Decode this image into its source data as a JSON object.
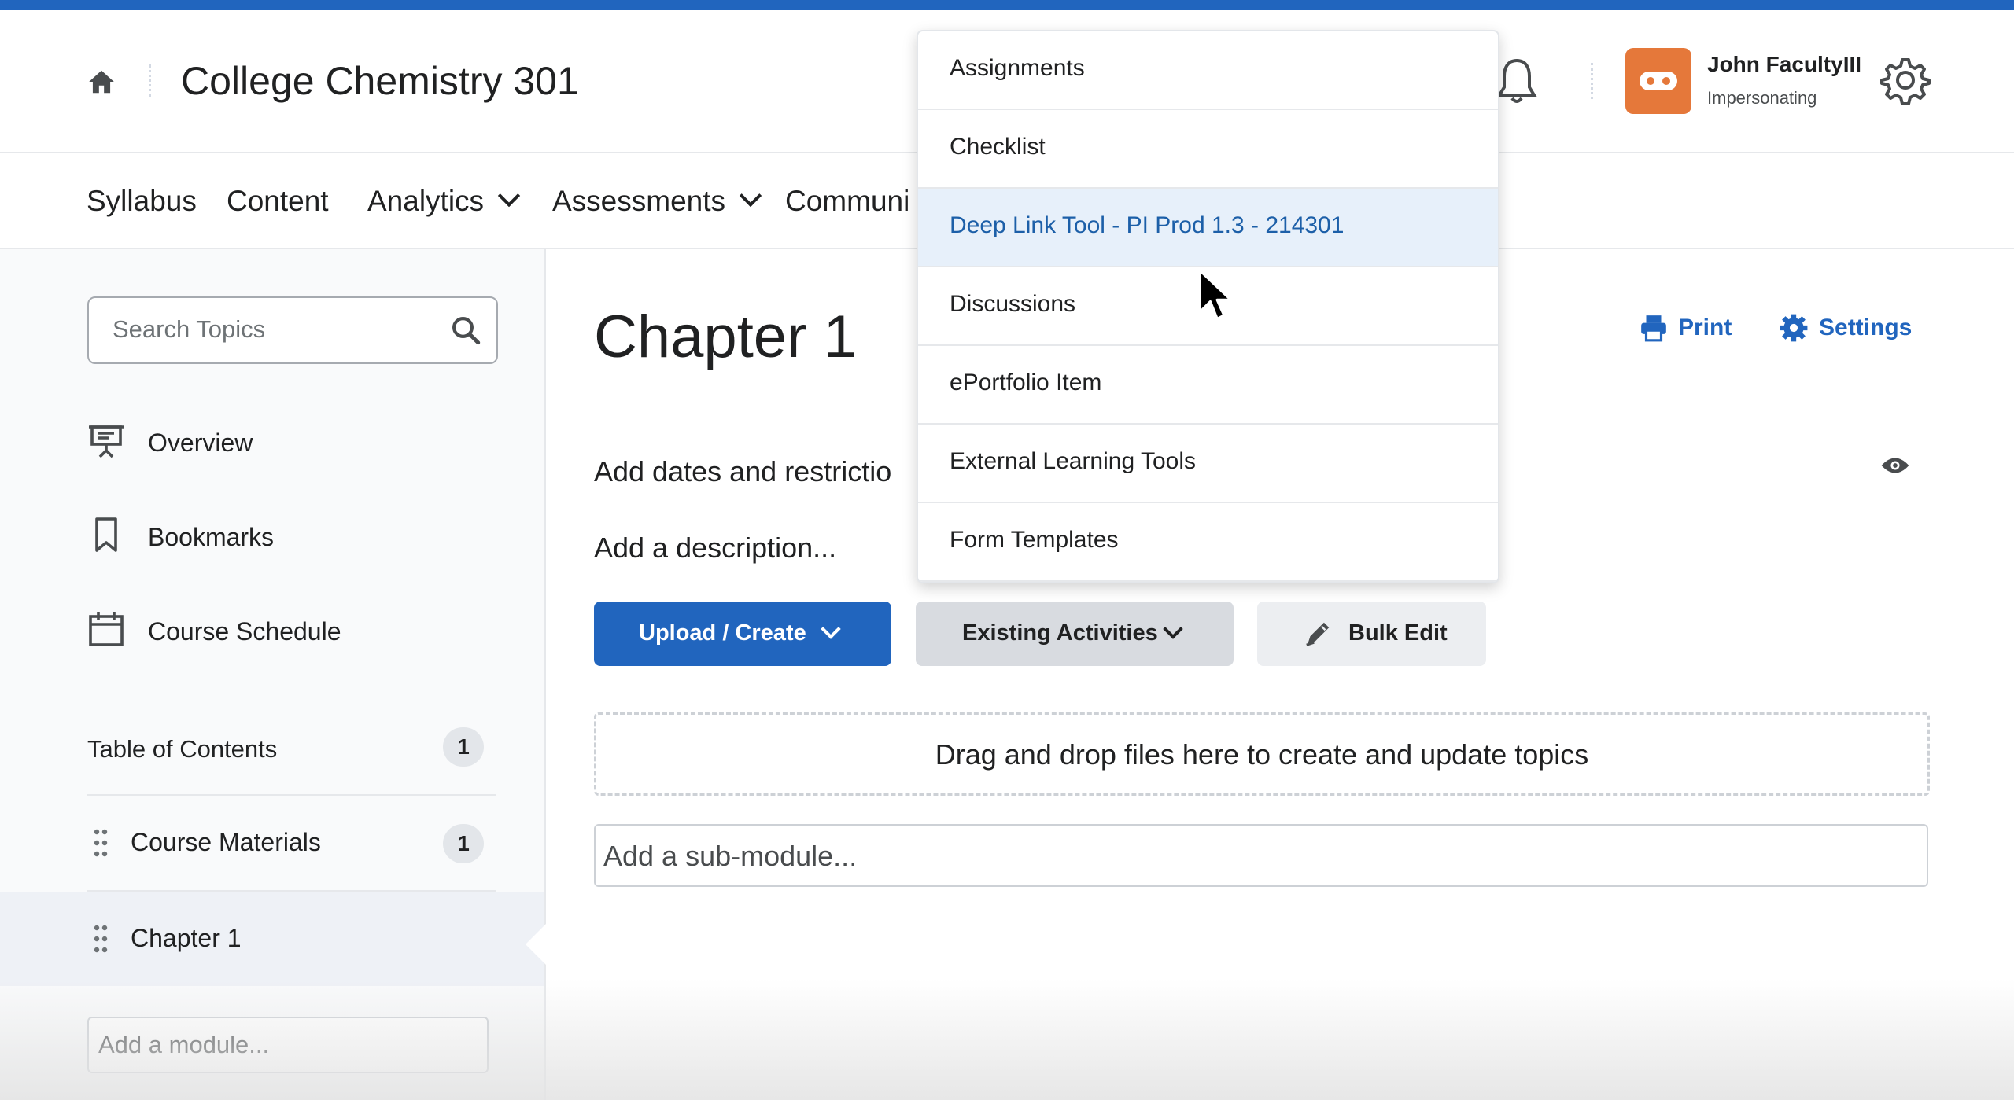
{
  "header": {
    "course_title": "College Chemistry 301",
    "user_name": "John FacultyIII",
    "user_status": "Impersonating"
  },
  "nav": {
    "items": [
      {
        "label": "Syllabus"
      },
      {
        "label": "Content"
      },
      {
        "label": "Analytics"
      },
      {
        "label": "Assessments"
      },
      {
        "label": "Communi"
      }
    ]
  },
  "sidebar": {
    "search_placeholder": "Search Topics",
    "links": [
      {
        "label": "Overview",
        "icon": "presentation-icon"
      },
      {
        "label": "Bookmarks",
        "icon": "bookmark-icon"
      },
      {
        "label": "Course Schedule",
        "icon": "calendar-icon"
      }
    ],
    "toc_label": "Table of Contents",
    "toc_count": "1",
    "modules": [
      {
        "label": "Course Materials",
        "count": "1"
      },
      {
        "label": "Chapter 1"
      }
    ],
    "add_module": "Add a module..."
  },
  "main": {
    "title": "Chapter 1",
    "print_label": "Print",
    "settings_label": "Settings",
    "dates_text": "Add dates and restrictio",
    "description_text": "Add a description...",
    "upload_label": "Upload / Create",
    "existing_label": "Existing Activities",
    "bulk_label": "Bulk Edit",
    "dropzone_text": "Drag and drop files here to create and update topics",
    "submodule_text": "Add a sub-module..."
  },
  "dropdown": {
    "items": [
      {
        "label": "Assignments"
      },
      {
        "label": "Checklist"
      },
      {
        "label": "Deep Link Tool - PI Prod 1.3 - 214301"
      },
      {
        "label": "Discussions"
      },
      {
        "label": "ePortfolio Item"
      },
      {
        "label": "External Learning Tools"
      },
      {
        "label": "Form Templates"
      }
    ],
    "highlighted_index": 2
  },
  "colors": {
    "accent": "#2165be",
    "avatar": "#e5783a"
  }
}
